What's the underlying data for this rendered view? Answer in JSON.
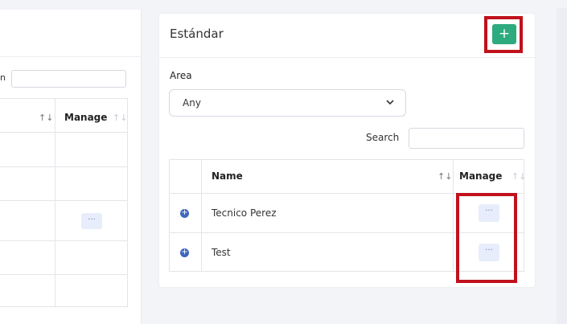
{
  "card": {
    "title": "Estándar",
    "add_label": "+"
  },
  "filter": {
    "area_label": "Area",
    "area_value": "Any"
  },
  "search": {
    "label": "Search",
    "value": ""
  },
  "table": {
    "columns": {
      "name": "Name",
      "manage": "Manage"
    },
    "rows": [
      {
        "name": "Tecnico Perez",
        "action": "···"
      },
      {
        "name": "Test",
        "action": "···"
      }
    ]
  },
  "left_panel": {
    "manage_label": "Manage",
    "search_label": "n",
    "action": "···"
  },
  "colors": {
    "accent": "#2eab7e",
    "highlight": "#c0111c",
    "row_icon": "#3f66bd"
  },
  "icons": {
    "sort": "sort-icon",
    "chevron": "chevron-down-icon",
    "expand": "plus-circle-icon"
  }
}
